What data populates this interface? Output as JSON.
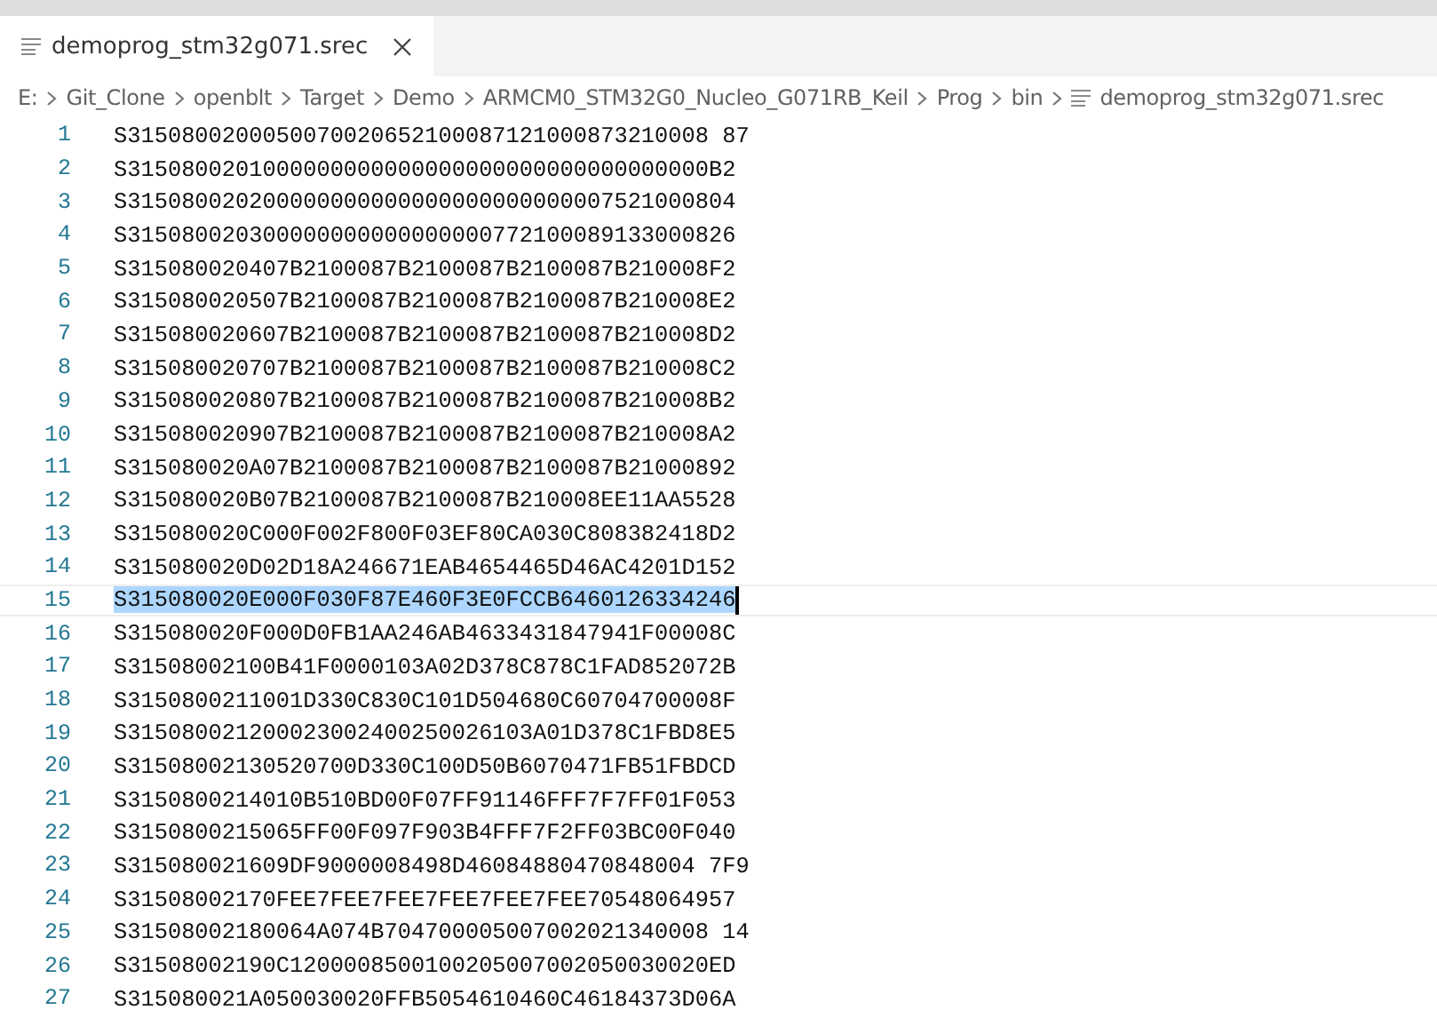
{
  "tab": {
    "label": "demoprog_stm32g071.srec",
    "selected": true
  },
  "breadcrumbs": [
    "E:",
    "Git_Clone",
    "openblt",
    "Target",
    "Demo",
    "ARMCM0_STM32G0_Nucleo_G071RB_Keil",
    "Prog",
    "bin",
    "demoprog_stm32g071.srec"
  ],
  "lines": [
    {
      "number": "1",
      "text": "S3150800200050070020652100087121000873210008 87",
      "selected": false
    },
    {
      "number": "2",
      "text": "S3150800201000000000000000000000000000000000B2",
      "selected": false
    },
    {
      "number": "3",
      "text": "S315080020200000000000000000000000007521000804",
      "selected": false
    },
    {
      "number": "4",
      "text": "S315080020300000000000000000772100089133000826",
      "selected": false
    },
    {
      "number": "5",
      "text": "S315080020407B2100087B2100087B2100087B210008F2",
      "selected": false
    },
    {
      "number": "6",
      "text": "S315080020507B2100087B2100087B2100087B210008E2",
      "selected": false
    },
    {
      "number": "7",
      "text": "S315080020607B2100087B2100087B2100087B210008D2",
      "selected": false
    },
    {
      "number": "8",
      "text": "S315080020707B2100087B2100087B2100087B210008C2",
      "selected": false
    },
    {
      "number": "9",
      "text": "S315080020807B2100087B2100087B2100087B210008B2",
      "selected": false
    },
    {
      "number": "10",
      "text": "S315080020907B2100087B2100087B2100087B210008A2",
      "selected": false
    },
    {
      "number": "11",
      "text": "S315080020A07B2100087B2100087B2100087B21000892",
      "selected": false
    },
    {
      "number": "12",
      "text": "S315080020B07B2100087B2100087B210008EE11AA5528",
      "selected": false
    },
    {
      "number": "13",
      "text": "S315080020C000F002F800F03EF80CA030C808382418D2",
      "selected": false
    },
    {
      "number": "14",
      "text": "S315080020D02D18A246671EAB4654465D46AC4201D152",
      "selected": false
    },
    {
      "number": "15",
      "text": "S315080020E000F030F87E460F3E0FCCB6460126334246",
      "selected": true
    },
    {
      "number": "16",
      "text": "S315080020F000D0FB1AA246AB4633431847941F00008C",
      "selected": false
    },
    {
      "number": "17",
      "text": "S31508002100B41F0000103A02D378C878C1FAD852072B",
      "selected": false
    },
    {
      "number": "18",
      "text": "S3150800211001D330C830C101D504680C60704700008F",
      "selected": false
    },
    {
      "number": "19",
      "text": "S315080021200023002400250026103A01D378C1FBD8E5",
      "selected": false
    },
    {
      "number": "20",
      "text": "S31508002130520700D330C100D50B6070471FB51FBDCD",
      "selected": false
    },
    {
      "number": "21",
      "text": "S3150800214010B510BD00F07FF91146FFF7F7FF01F053",
      "selected": false
    },
    {
      "number": "22",
      "text": "S3150800215065FF00F097F903B4FFF7F2FF03BC00F040",
      "selected": false
    },
    {
      "number": "23",
      "text": "S315080021609DF9000008498D46084880470848004 7F9",
      "selected": false
    },
    {
      "number": "24",
      "text": "S31508002170FEE7FEE7FEE7FEE7FEE7FEE70548064957",
      "selected": false
    },
    {
      "number": "25",
      "text": "S31508002180064A074B704700005007002021340008 14",
      "selected": false
    },
    {
      "number": "26",
      "text": "S31508002190C1200008500100205007002050030020ED",
      "selected": false
    },
    {
      "number": "27",
      "text": "S315080021A050030020FFB5054610460C46184373D06A",
      "selected": false
    }
  ]
}
